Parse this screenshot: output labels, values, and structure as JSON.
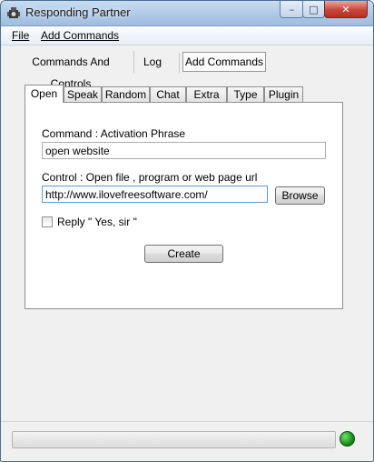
{
  "window": {
    "title": "Responding Partner"
  },
  "menu": {
    "file": "File",
    "add_commands": "Add Commands"
  },
  "top_tabs": [
    "Commands And Controls",
    "Log",
    "Add Commands"
  ],
  "inner_tabs": [
    "Open",
    "Speak",
    "Random",
    "Chat",
    "Extra",
    "Type",
    "Plugin"
  ],
  "form": {
    "command_label": "Command : Activation Phrase",
    "command_value": "open website",
    "control_label": "Control : Open file , program or web page url",
    "control_value": "http://www.ilovefreesoftware.com/",
    "browse_label": "Browse",
    "reply_label": "Reply \" Yes, sir \"",
    "reply_checked": false,
    "create_label": "Create"
  },
  "status": {
    "progress": 0,
    "indicator_color": "#1a8f1a"
  },
  "icons": {
    "app": "app-icon",
    "minimize": "minimize-icon",
    "maximize": "maximize-icon",
    "close": "close-icon"
  }
}
